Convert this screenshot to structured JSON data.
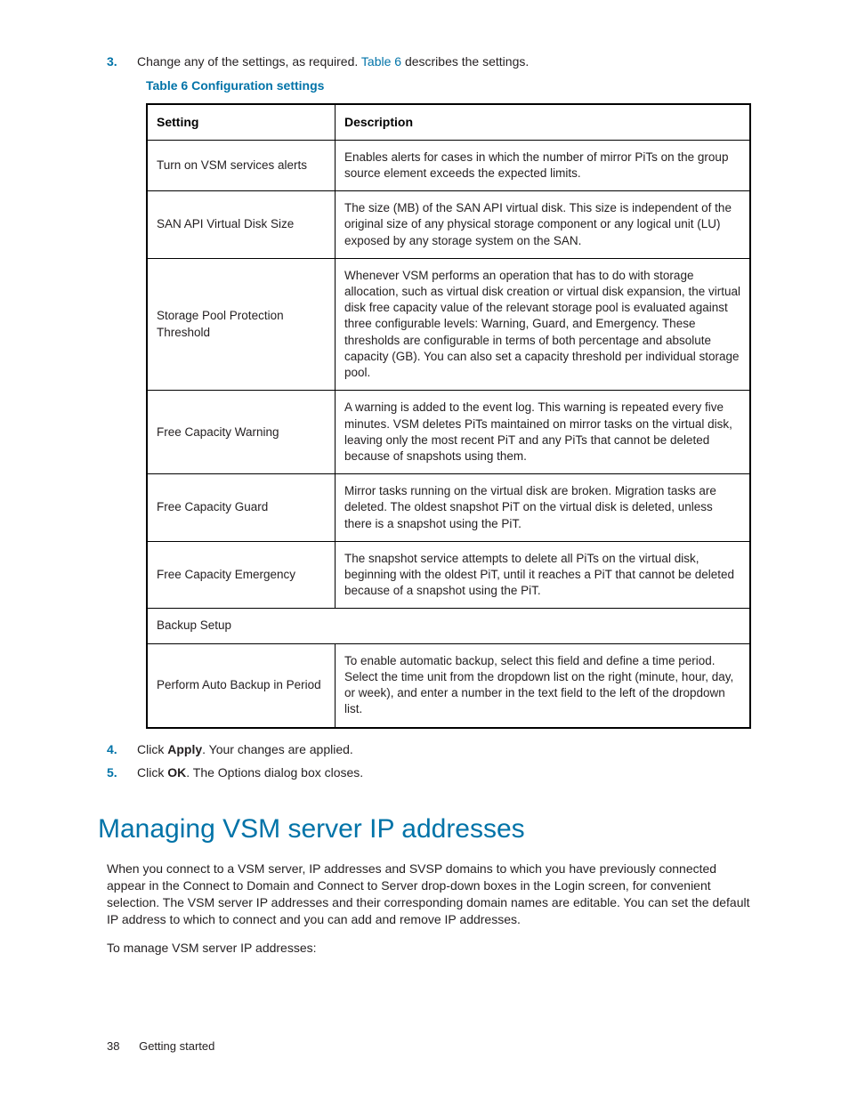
{
  "steps_top": {
    "num3": "3.",
    "text3_a": "Change any of the settings, as required. ",
    "text3_link": "Table 6",
    "text3_b": " describes the settings."
  },
  "table_title": "Table 6 Configuration settings",
  "table": {
    "head_setting": "Setting",
    "head_description": "Description",
    "rows": [
      {
        "setting": "Turn on VSM services alerts",
        "desc": "Enables alerts for cases in which the number of mirror PiTs on the group source element exceeds the expected limits."
      },
      {
        "setting": "SAN API Virtual Disk Size",
        "desc": "The size (MB) of the SAN API virtual disk. This size is independent of the original size of any physical storage component or any logical unit (LU) exposed by any storage system on the SAN."
      },
      {
        "setting": "Storage Pool Protection Threshold",
        "desc": "Whenever VSM performs an operation that has to do with storage allocation, such as virtual disk creation or virtual disk expansion, the virtual disk free capacity value of the relevant storage pool is evaluated against three configurable levels: Warning, Guard, and Emergency. These thresholds are configurable in terms of both percentage and absolute capacity (GB). You can also set a capacity threshold per individual storage pool."
      },
      {
        "setting": "Free Capacity Warning",
        "desc": "A warning is added to the event log. This warning is repeated every five minutes. VSM deletes PiTs maintained on mirror tasks on the virtual disk, leaving only the most recent PiT and any PiTs that cannot be deleted because of snapshots using them."
      },
      {
        "setting": "Free Capacity Guard",
        "desc": "Mirror tasks running on the virtual disk are broken. Migration tasks are deleted. The oldest snapshot PiT on the virtual disk is deleted, unless there is a snapshot using the PiT."
      },
      {
        "setting": "Free Capacity Emergency",
        "desc": "The snapshot service attempts to delete all PiTs on the virtual disk, beginning with the oldest PiT, until it reaches a PiT that cannot be deleted because of a snapshot using the PiT."
      },
      {
        "setting": "Backup Setup",
        "desc": "",
        "span": true
      },
      {
        "setting": "Perform Auto Backup in Period",
        "desc": "To enable automatic backup, select this field and define a time period. Select the time unit from the dropdown list on the right (minute, hour, day, or week), and enter a number in the text field to the left of the dropdown list."
      }
    ]
  },
  "steps_bottom": {
    "num4": "4.",
    "text4_a": "Click ",
    "text4_bold": "Apply",
    "text4_b": ". Your changes are applied.",
    "num5": "5.",
    "text5_a": "Click ",
    "text5_bold": "OK",
    "text5_b": ". The Options dialog box closes."
  },
  "section_heading": "Managing VSM server IP addresses",
  "section_p1": "When you connect to a VSM server, IP addresses and SVSP domains to which you have previously connected appear in the Connect to Domain and Connect to Server drop-down boxes in the Login screen, for convenient selection. The VSM server IP addresses and their corresponding domain names are editable. You can set the default IP address to which to connect and you can add and remove IP addresses.",
  "section_p2": "To manage VSM server IP addresses:",
  "footer": {
    "page": "38",
    "label": "Getting started"
  }
}
